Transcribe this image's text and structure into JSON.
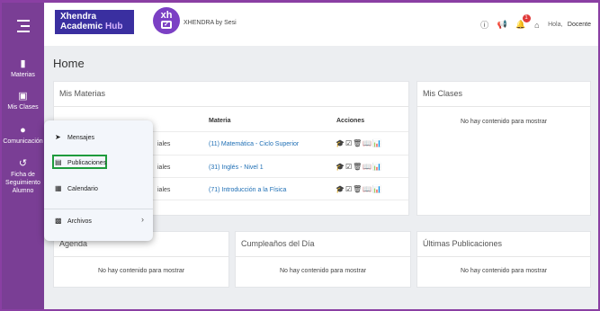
{
  "sidebar": {
    "items": [
      {
        "label": "Materias",
        "icon": "clipboard-icon"
      },
      {
        "label": "Mis Clases",
        "icon": "presentation-icon"
      },
      {
        "label": "Comunicación",
        "icon": "chat-icon"
      },
      {
        "label_lines": [
          "Ficha de",
          "Seguimiento",
          "Alumno"
        ],
        "icon": "history-icon"
      }
    ]
  },
  "header": {
    "logo_line1": "Xhendra",
    "logo_line2a": "Academic ",
    "logo_line2b": "Hub",
    "xh_text": "xh",
    "brand_name": "XHENDRA by Sesi",
    "notifications_count": "1",
    "greeting": "Hola,",
    "user": "Docente"
  },
  "main": {
    "title": "Home",
    "mis_materias": {
      "title": "Mis Materias",
      "columns": {
        "materia": "Materia",
        "acciones": "Acciones"
      },
      "rows": [
        {
          "partial": "iales",
          "subject": "(11) Matemática - Ciclo Superior"
        },
        {
          "partial": "iales",
          "subject": "(31) Inglés - Nivel 1"
        },
        {
          "partial": "iales",
          "subject": "(71) Introducción a la Física"
        }
      ],
      "action_glyphs": "🎓☑🗑📖📊"
    },
    "mis_clases": {
      "title": "Mis Clases",
      "empty": "No hay contenido para mostrar"
    },
    "agenda": {
      "title": "Agenda",
      "empty": "No hay contenido para mostrar"
    },
    "cumpleanos": {
      "title": "Cumpleaños del Día",
      "empty": "No hay contenido para mostrar"
    },
    "publicaciones": {
      "title": "Últimas Publicaciones",
      "empty": "No hay contenido para mostrar"
    }
  },
  "popup_menu": {
    "items": [
      {
        "label": "Mensajes",
        "icon": "send-icon"
      },
      {
        "label": "Publicaciones",
        "icon": "newspaper-icon"
      },
      {
        "label": "Calendario",
        "icon": "calendar-icon"
      },
      {
        "label": "Archivos",
        "icon": "archive-icon"
      }
    ],
    "highlight_color": "#1e9b3c"
  },
  "colors": {
    "sidebar": "#7a3e95",
    "link": "#1f6fb5",
    "background": "#eceef1"
  }
}
